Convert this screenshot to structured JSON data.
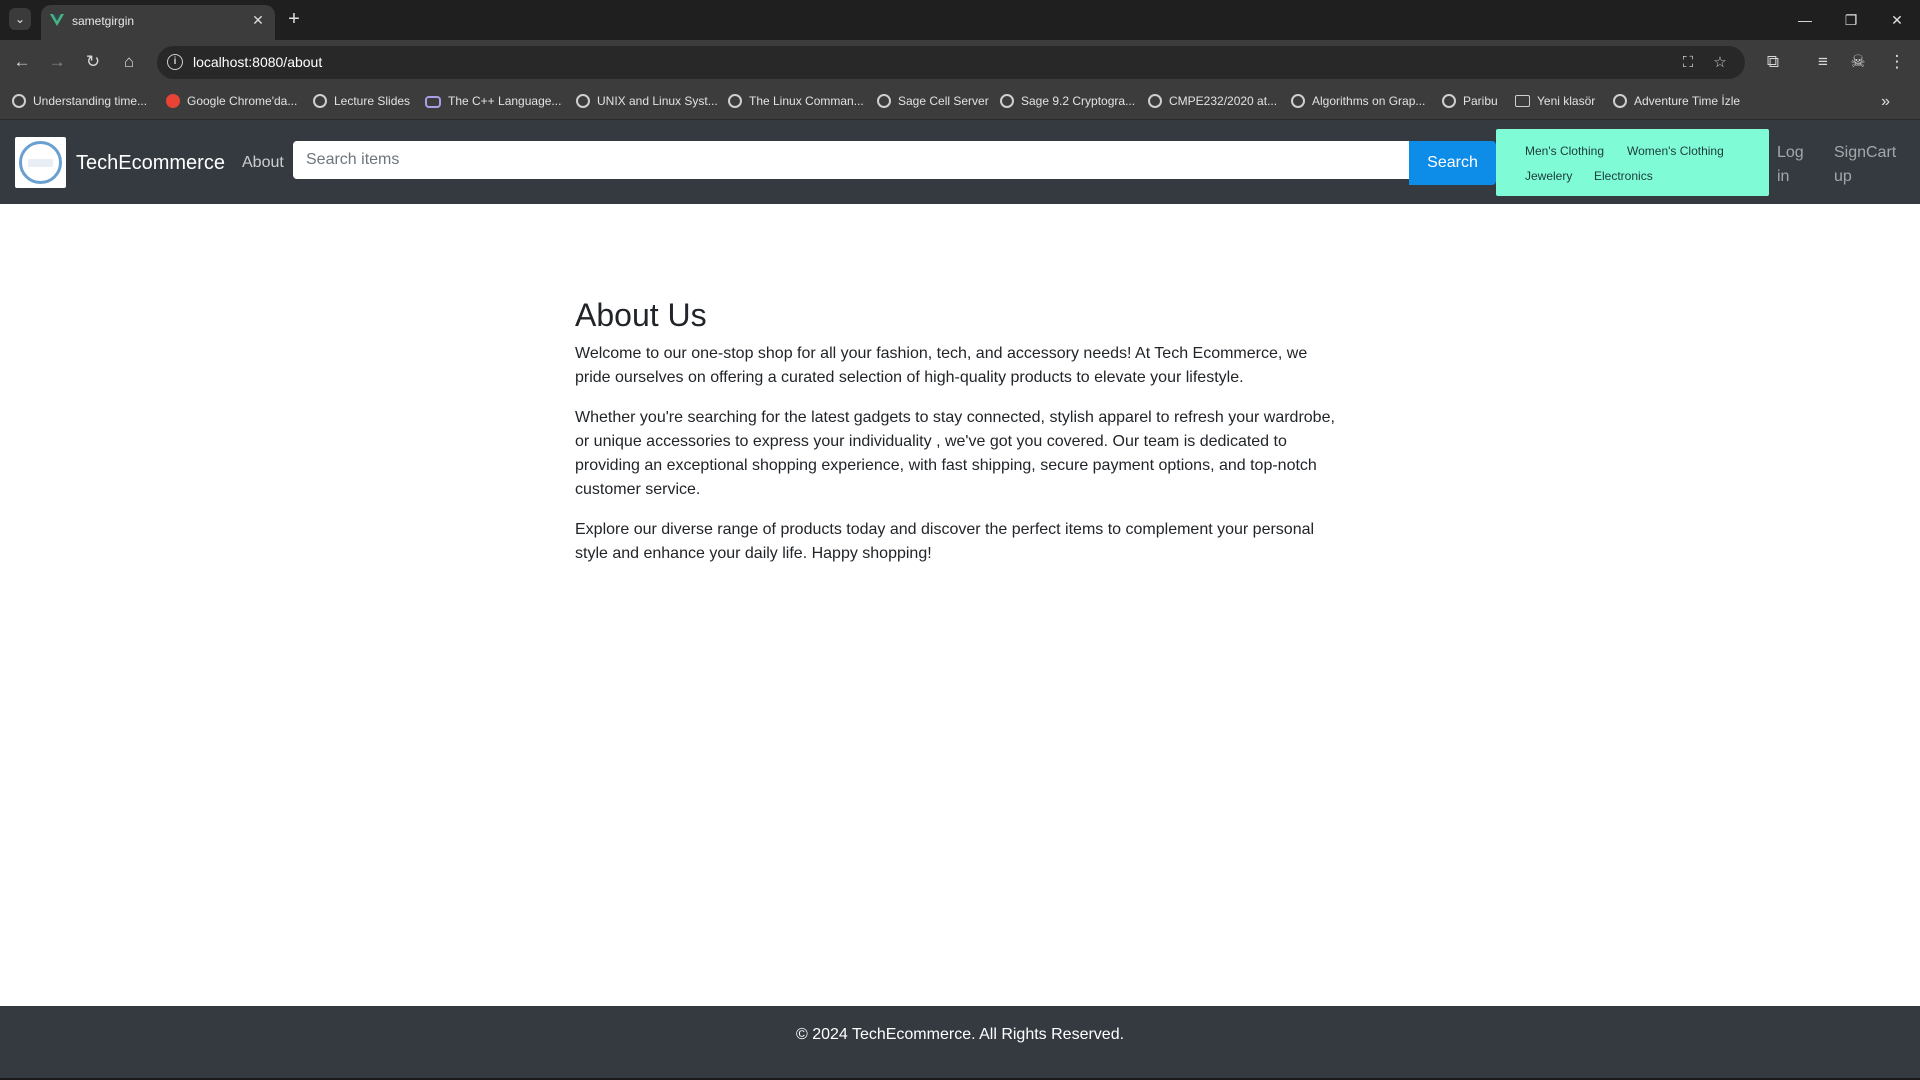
{
  "browser": {
    "tab": {
      "title": "sametgirgin"
    },
    "url": {
      "host": "localhost",
      "rest": ":8080/about"
    },
    "bookmarks": [
      {
        "label": "Understanding time...",
        "icon": "globe-icon"
      },
      {
        "label": "Google Chrome'da...",
        "icon": "chrome-red-icon"
      },
      {
        "label": "Lecture Slides",
        "icon": "globe-icon"
      },
      {
        "label": "The C++ Language...",
        "icon": "cloud-icon"
      },
      {
        "label": "UNIX and Linux Syst...",
        "icon": "globe-icon"
      },
      {
        "label": "The Linux Comman...",
        "icon": "globe-icon"
      },
      {
        "label": "Sage Cell Server",
        "icon": "globe-icon"
      },
      {
        "label": "Sage 9.2 Cryptogra...",
        "icon": "globe-icon"
      },
      {
        "label": "CMPE232/2020 at...",
        "icon": "globe-icon"
      },
      {
        "label": "Algorithms on Grap...",
        "icon": "globe-icon"
      },
      {
        "label": "Paribu",
        "icon": "globe-icon"
      },
      {
        "label": "Yeni klasör",
        "icon": "folder-icon"
      },
      {
        "label": "Adventure Time İzle",
        "icon": "globe-icon"
      }
    ]
  },
  "navbar": {
    "brand": "TechEcommerce",
    "about": "About",
    "search": {
      "placeholder": "Search items",
      "button": "Search"
    },
    "categories": [
      "Men's Clothing",
      "Women's Clothing",
      "Jewelery",
      "Electronics"
    ],
    "login": {
      "line1": "Log",
      "line2": "in"
    },
    "signup": {
      "line1": "Sign",
      "line2": "up"
    },
    "cart": "Cart"
  },
  "about": {
    "title": "About Us",
    "paragraphs": [
      "Welcome to our one-stop shop for all your fashion, tech, and accessory needs! At Tech Ecommerce, we pride ourselves on offering a curated selection of high-quality products to elevate your lifestyle.",
      "Whether you're searching for the latest gadgets to stay connected, stylish apparel to refresh your wardrobe, or unique accessories to express your individuality , we've got you covered. Our team is dedicated to providing an exceptional shopping experience, with fast shipping, secure payment options, and top-notch customer service.",
      "Explore our diverse range of products today and discover the perfect items to complement your personal style and enhance your daily life. Happy shopping!"
    ]
  },
  "footer": {
    "text": "© 2024 TechEcommerce. All Rights Reserved."
  },
  "colors": {
    "navbar": "#343a40",
    "search_button": "#0d8ce8",
    "categories_bg": "#7ffbd6"
  }
}
